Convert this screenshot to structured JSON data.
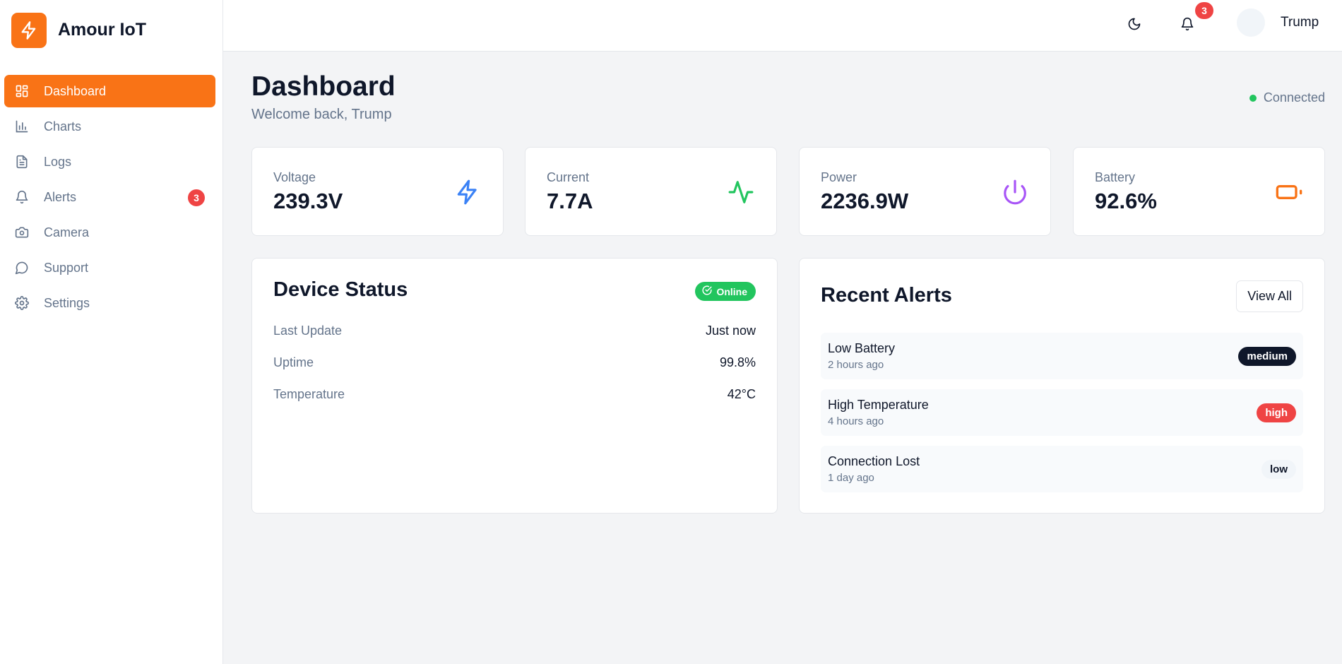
{
  "brand": {
    "name": "Amour IoT"
  },
  "sidebar": {
    "items": [
      {
        "label": "Dashboard",
        "icon": "dashboard-icon",
        "active": true
      },
      {
        "label": "Charts",
        "icon": "chart-icon"
      },
      {
        "label": "Logs",
        "icon": "file-icon"
      },
      {
        "label": "Alerts",
        "icon": "bell-icon",
        "badge": "3"
      },
      {
        "label": "Camera",
        "icon": "camera-icon"
      },
      {
        "label": "Support",
        "icon": "chat-icon"
      },
      {
        "label": "Settings",
        "icon": "gear-icon"
      }
    ]
  },
  "topbar": {
    "notification_count": "3",
    "user_name": "Trump"
  },
  "header": {
    "title": "Dashboard",
    "subtitle": "Welcome back, Trump",
    "connection_status": "Connected"
  },
  "stats": [
    {
      "label": "Voltage",
      "value": "239.3V",
      "icon": "lightning-icon",
      "color": "#3b82f6"
    },
    {
      "label": "Current",
      "value": "7.7A",
      "icon": "activity-icon",
      "color": "#22c55e"
    },
    {
      "label": "Power",
      "value": "2236.9W",
      "icon": "power-icon",
      "color": "#a855f7"
    },
    {
      "label": "Battery",
      "value": "92.6%",
      "icon": "battery-icon",
      "color": "#f97316"
    }
  ],
  "device_status": {
    "title": "Device Status",
    "badge": "Online",
    "rows": [
      {
        "label": "Last Update",
        "value": "Just now"
      },
      {
        "label": "Uptime",
        "value": "99.8%"
      },
      {
        "label": "Temperature",
        "value": "42°C"
      }
    ]
  },
  "recent_alerts": {
    "title": "Recent Alerts",
    "view_all_label": "View All",
    "items": [
      {
        "title": "Low Battery",
        "time": "2 hours ago",
        "severity": "medium"
      },
      {
        "title": "High Temperature",
        "time": "4 hours ago",
        "severity": "high"
      },
      {
        "title": "Connection Lost",
        "time": "1 day ago",
        "severity": "low"
      }
    ]
  },
  "colors": {
    "accent": "#f97316",
    "success": "#22c55e",
    "danger": "#ef4444",
    "dark": "#0f172a",
    "muted": "#64748b"
  }
}
